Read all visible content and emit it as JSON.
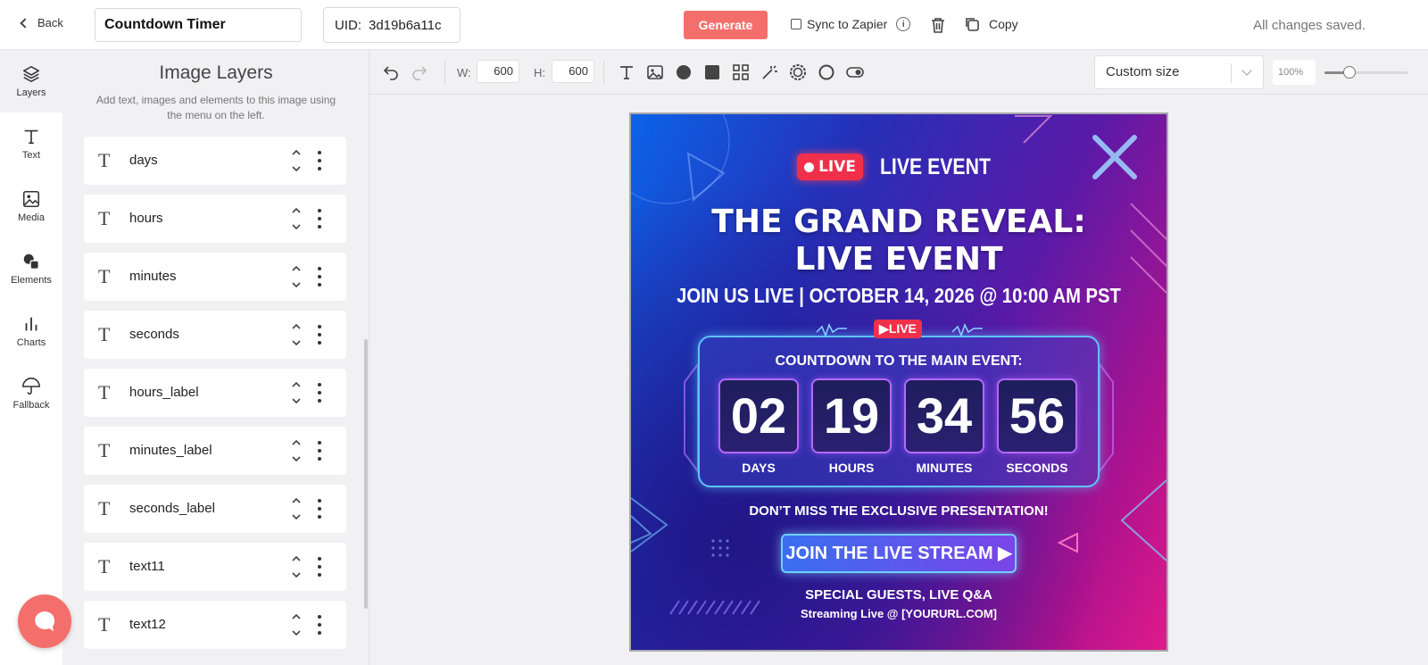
{
  "header": {
    "back_label": "Back",
    "title_value": "Countdown Timer",
    "uid_label": "UID:",
    "uid_value": "3d19b6a11c",
    "generate_label": "Generate",
    "sync_label": "Sync to Zapier",
    "copy_label": "Copy",
    "status": "All changes saved."
  },
  "rail": [
    {
      "label": "Layers",
      "icon": "layers-icon"
    },
    {
      "label": "Text",
      "icon": "text-icon"
    },
    {
      "label": "Media",
      "icon": "image-icon"
    },
    {
      "label": "Elements",
      "icon": "shapes-icon"
    },
    {
      "label": "Charts",
      "icon": "bar-chart-icon"
    },
    {
      "label": "Fallback",
      "icon": "umbrella-icon"
    }
  ],
  "panel": {
    "title": "Image Layers",
    "subtitle": "Add text, images and elements to this image using the menu on the left.",
    "layers": [
      {
        "name": "days"
      },
      {
        "name": "hours"
      },
      {
        "name": "minutes"
      },
      {
        "name": "seconds"
      },
      {
        "name": "hours_label"
      },
      {
        "name": "minutes_label"
      },
      {
        "name": "seconds_label"
      },
      {
        "name": "text11"
      },
      {
        "name": "text12"
      }
    ],
    "layer_type_glyph": "T"
  },
  "toolbar": {
    "width_label": "W:",
    "width_value": "600",
    "height_label": "H:",
    "height_value": "600",
    "size_preset": "Custom size",
    "zoom": "100%",
    "zoom_level": 0.3
  },
  "poster": {
    "live_pill": "LIVE",
    "live_event": "LIVE EVENT",
    "title_line1": "THE GRAND REVEAL:",
    "title_line2": "LIVE EVENT",
    "date_line": "JOIN US LIVE | OCTOBER 14, 2026 @ 10:00 AM PST",
    "live_badge": "▶LIVE",
    "countdown_heading": "COUNTDOWN TO THE MAIN EVENT:",
    "units": [
      {
        "value": "02",
        "label": "DAYS"
      },
      {
        "value": "19",
        "label": "HOURS"
      },
      {
        "value": "34",
        "label": "MINUTES"
      },
      {
        "value": "56",
        "label": "SECONDS"
      }
    ],
    "miss_line": "DON’T MISS THE EXCLUSIVE PRESENTATION!",
    "cta_label": "JOIN THE LIVE STREAM ▶",
    "guests_line": "SPECIAL GUESTS, LIVE Q&A",
    "url_line": "Streaming Live @ [YOURURL.COM]"
  },
  "colors": {
    "accent": "#f46f6c",
    "poster_blue": "#0c63e8",
    "poster_pink": "#e01a8a"
  }
}
